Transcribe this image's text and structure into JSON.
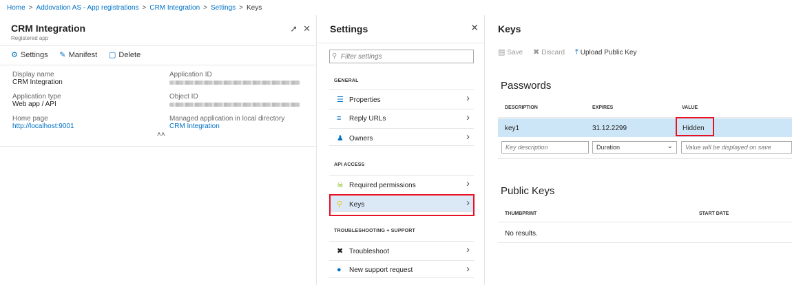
{
  "breadcrumb": {
    "items": [
      "Home",
      "Addovation AS - App registrations",
      "CRM Integration",
      "Settings"
    ],
    "current": "Keys",
    "separator": ">"
  },
  "app_blade": {
    "title": "CRM Integration",
    "subtitle": "Registered app",
    "toolbar": {
      "settings": "Settings",
      "manifest": "Manifest",
      "delete": "Delete"
    },
    "props": {
      "display_name_label": "Display name",
      "display_name": "CRM Integration",
      "app_type_label": "Application type",
      "app_type": "Web app / API",
      "home_page_label": "Home page",
      "home_page": "http://localhost:9001",
      "app_id_label": "Application ID",
      "object_id_label": "Object ID",
      "managed_label": "Managed application in local directory",
      "managed_value": "CRM Integration"
    }
  },
  "settings_blade": {
    "title": "Settings",
    "filter_placeholder": "Filter settings",
    "sections": {
      "general": "GENERAL",
      "api_access": "API ACCESS",
      "troubleshooting": "TROUBLESHOOTING + SUPPORT"
    },
    "items": {
      "properties": "Properties",
      "reply_urls": "Reply URLs",
      "owners": "Owners",
      "required_permissions": "Required permissions",
      "keys": "Keys",
      "troubleshoot": "Troubleshoot",
      "new_support_request": "New support request"
    }
  },
  "keys_blade": {
    "title": "Keys",
    "toolbar": {
      "save": "Save",
      "discard": "Discard",
      "upload": "Upload Public Key"
    },
    "passwords": {
      "title": "Passwords",
      "columns": [
        "DESCRIPTION",
        "EXPIRES",
        "VALUE"
      ],
      "row": {
        "description": "key1",
        "expires": "31.12.2299",
        "value": "Hidden"
      },
      "new_row": {
        "description_placeholder": "Key description",
        "duration": "Duration",
        "value_placeholder": "Value will be displayed on save"
      }
    },
    "public_keys": {
      "title": "Public Keys",
      "columns": [
        "THUMBPRINT",
        "START DATE"
      ],
      "empty": "No results."
    }
  },
  "colors": {
    "accent": "#0072c6",
    "highlight_red": "#e81123",
    "selected_row": "#cde6f7"
  }
}
